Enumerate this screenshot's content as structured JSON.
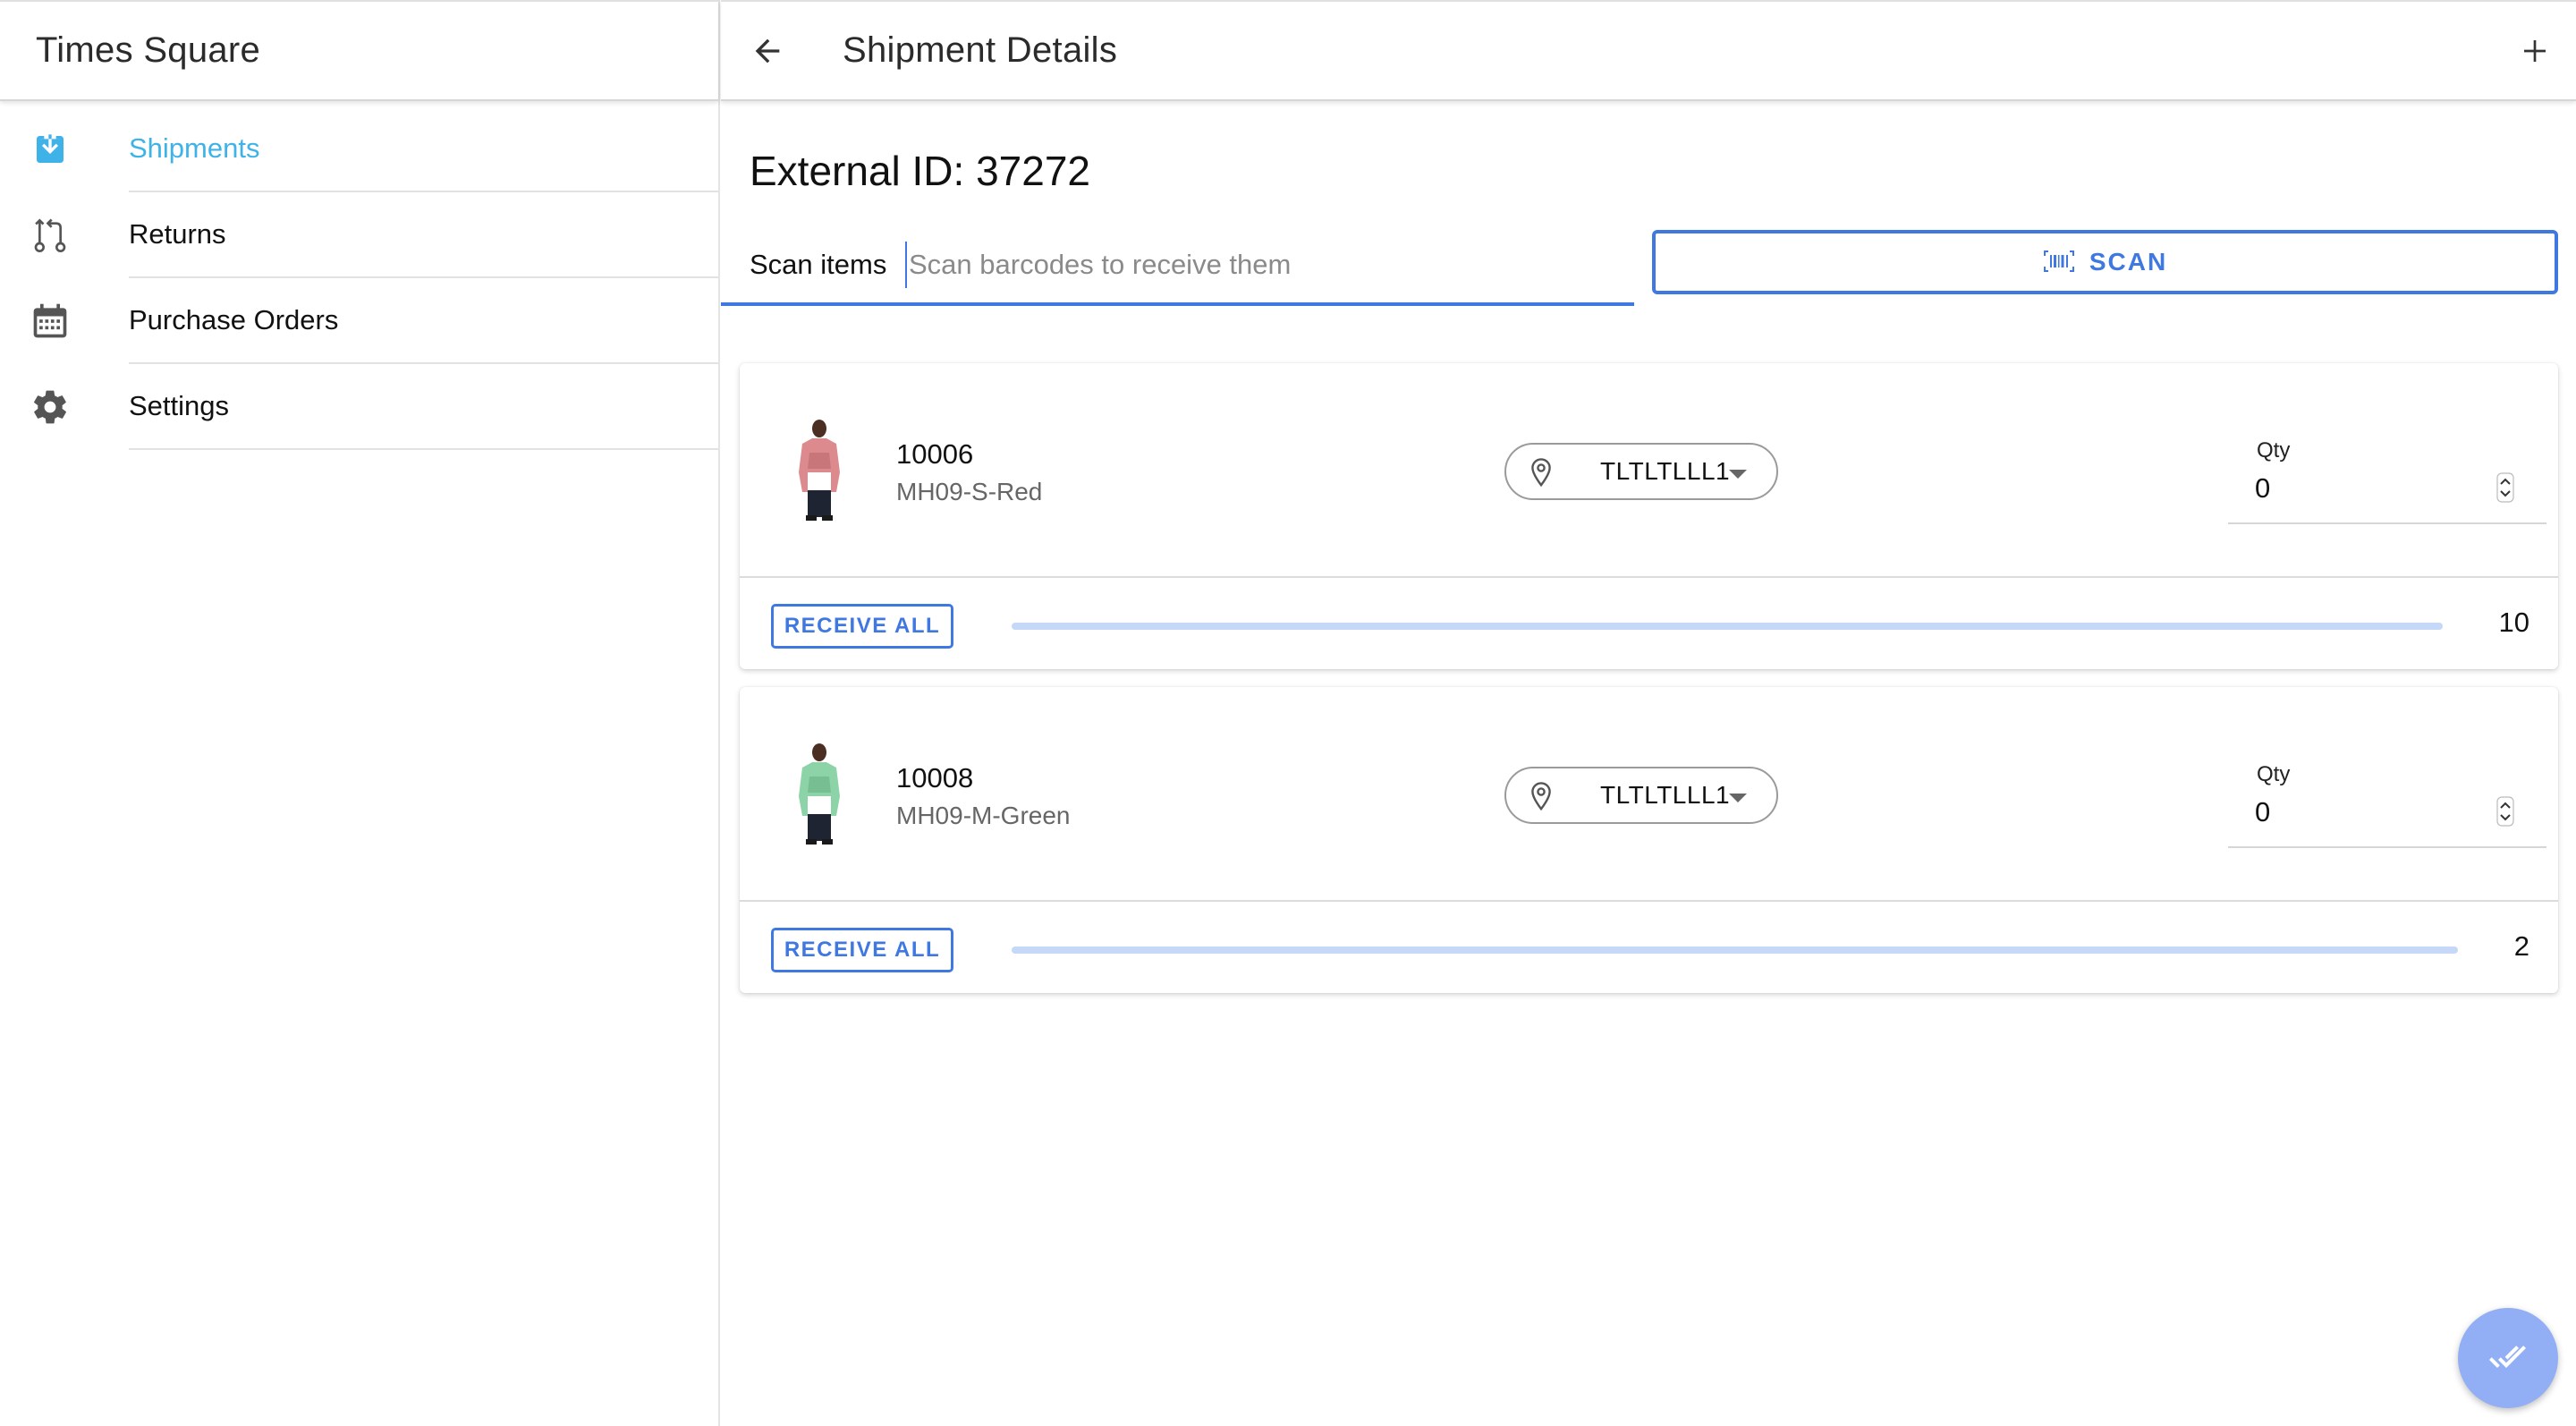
{
  "sidebar": {
    "title": "Times Square",
    "items": [
      {
        "label": "Shipments",
        "icon": "download-box-icon",
        "active": true
      },
      {
        "label": "Returns",
        "icon": "git-compare-icon",
        "active": false
      },
      {
        "label": "Purchase Orders",
        "icon": "calendar-icon",
        "active": false
      },
      {
        "label": "Settings",
        "icon": "gear-icon",
        "active": false
      }
    ]
  },
  "toolbar": {
    "title": "Shipment Details",
    "back_icon": "arrow-back-icon",
    "add_icon": "plus-icon"
  },
  "shipment": {
    "external_id_label": "External ID: 37272"
  },
  "scan": {
    "label": "Scan items",
    "placeholder": "Scan barcodes to receive them",
    "button_label": "SCAN",
    "button_icon": "barcode-icon"
  },
  "items": [
    {
      "product_id": "10006",
      "sku": "MH09-S-Red",
      "image_color": "#dc8a8e",
      "location": "TLTLTLLL1",
      "qty_label": "Qty",
      "qty_value": "0",
      "receive_all_label": "RECEIVE ALL",
      "received": 0,
      "expected": "10"
    },
    {
      "product_id": "10008",
      "sku": "MH09-M-Green",
      "image_color": "#8dd3a8",
      "location": "TLTLTLLL1",
      "qty_label": "Qty",
      "qty_value": "0",
      "receive_all_label": "RECEIVE ALL",
      "received": 0,
      "expected": "2"
    }
  ],
  "fab": {
    "icon": "double-check-icon"
  },
  "colors": {
    "accent": "#3f78e0",
    "active_nav": "#3fb2e8",
    "fab": "#92aef5",
    "progress_track": "#c6d8f7"
  }
}
